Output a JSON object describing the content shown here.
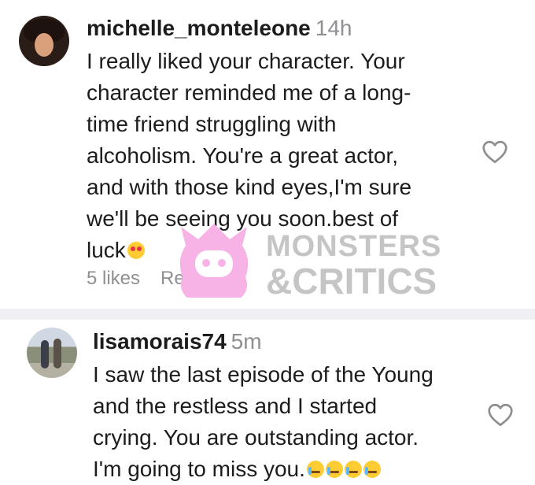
{
  "comments": [
    {
      "username": "michelle_monteleone",
      "time": "14h",
      "lines": [
        "I really liked your character. Your",
        "character reminded me of a long-",
        "time friend struggling with",
        "alcoholism. You're a great actor,",
        "and with those kind eyes,I'm sure",
        "we'll be seeing you soon.best of",
        "luck"
      ],
      "likes": "5 likes",
      "reply": "Reply",
      "emoji": "heart-eyes-emoji"
    },
    {
      "username": "lisamorais74",
      "time": "5m",
      "lines": [
        "I saw the last episode of the Young",
        "and the restless and I started",
        "crying. You are outstanding actor.",
        "I'm going to miss you."
      ],
      "emoji": "crying-face-emoji",
      "emoji_count": 4
    }
  ],
  "watermark": {
    "line1": "MONSTERS",
    "line2": "&CRITICS",
    "mascot_color": "#f7b3e6",
    "text_color": "#969696"
  },
  "icons": {
    "like": "heart-outline-icon"
  },
  "colors": {
    "separator": "#efeff4",
    "secondary_text": "#8e8e93",
    "primary_text": "#1c1c1e"
  }
}
